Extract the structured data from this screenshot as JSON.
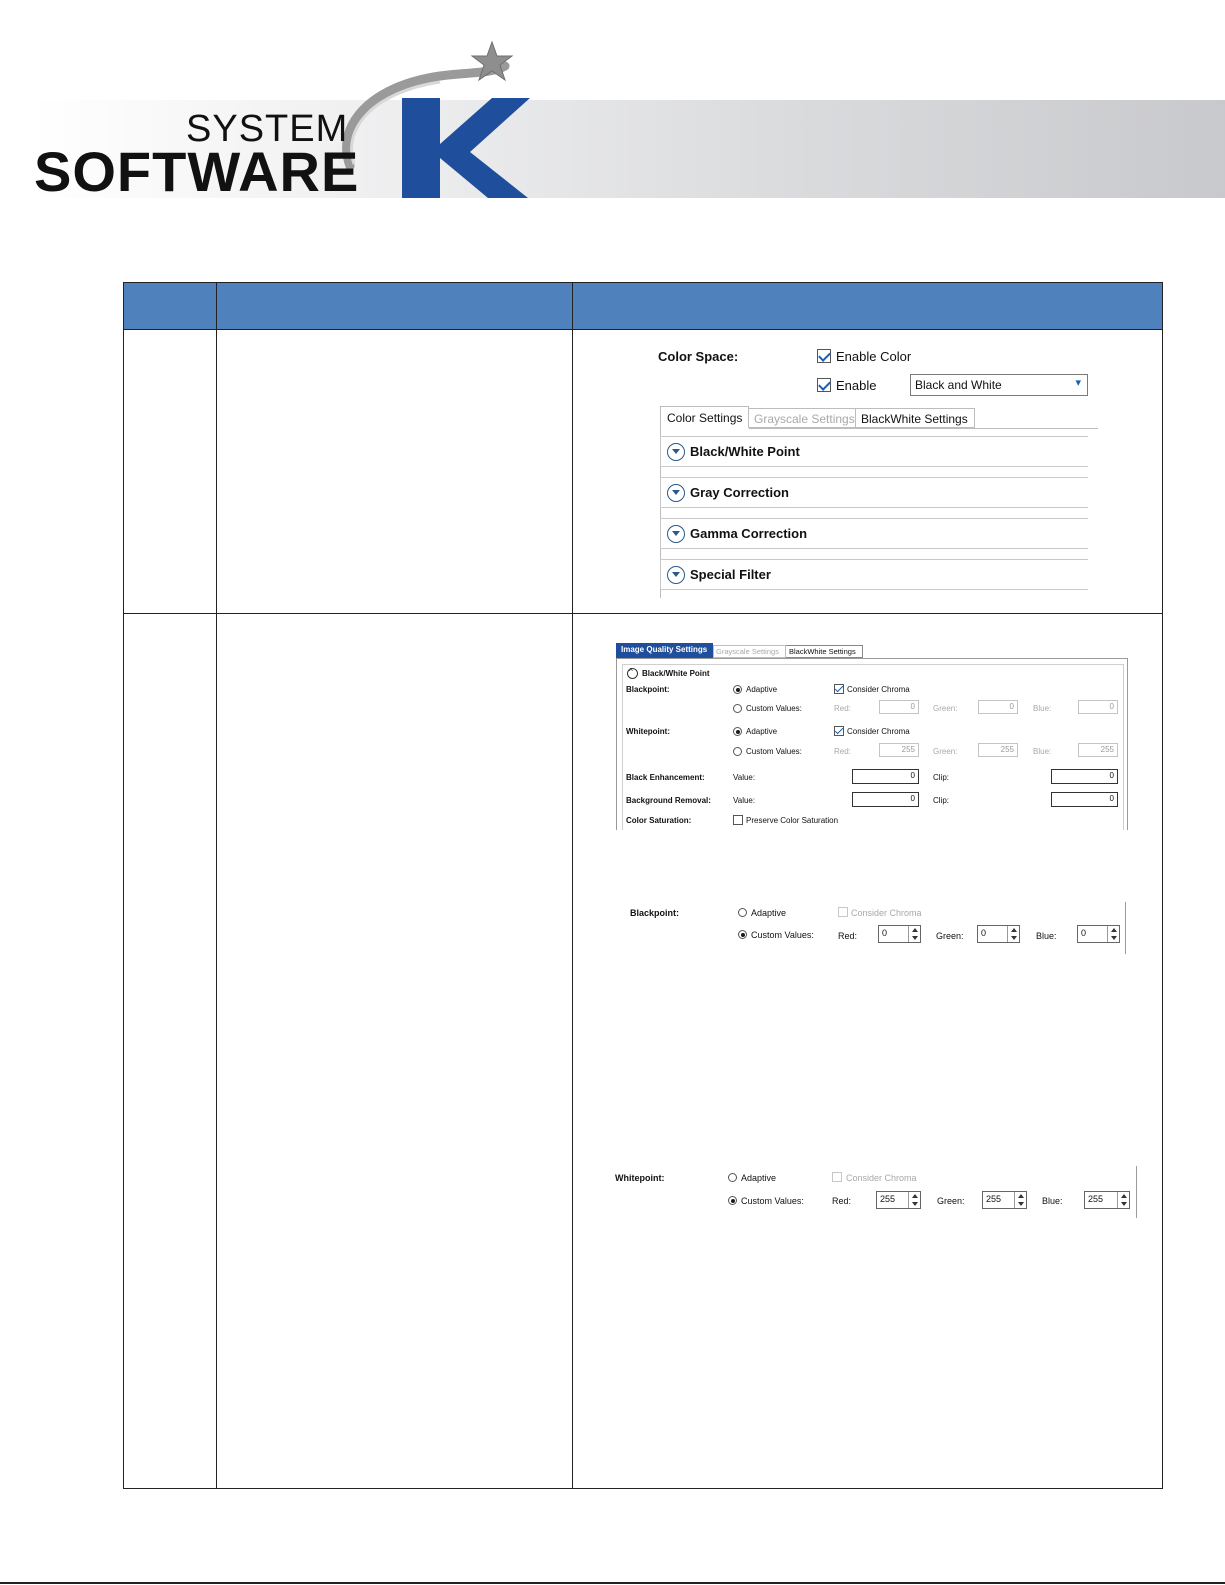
{
  "logo": {
    "line1": "SYSTEM",
    "line2": "SOFTWARE",
    "letter": "K"
  },
  "color_space": {
    "label": "Color Space:",
    "enable_color_label": "Enable Color",
    "enable_label": "Enable",
    "mode_value": "Black and White",
    "tabs": [
      "Color Settings",
      "Grayscale Settings",
      "BlackWhite Settings"
    ],
    "sections": [
      "Black/White Point",
      "Gray Correction",
      "Gamma Correction",
      "Special Filter"
    ]
  },
  "iq": {
    "tabs": [
      "Image Quality Settings",
      "Grayscale Settings",
      "BlackWhite Settings"
    ],
    "section_title": "Black/White Point",
    "blackpoint_label": "Blackpoint:",
    "whitepoint_label": "Whitepoint:",
    "adaptive": "Adaptive",
    "consider_chroma": "Consider Chroma",
    "custom_values": "Custom Values:",
    "red": "Red:",
    "green": "Green:",
    "blue": "Blue:",
    "bp_values": [
      "0",
      "0",
      "0"
    ],
    "wp_values": [
      "255",
      "255",
      "255"
    ],
    "black_enhancement_label": "Black Enhancement:",
    "background_removal_label": "Background Removal:",
    "color_saturation_label": "Color Saturation:",
    "value_label": "Value:",
    "clip_label": "Clip:",
    "be_value": "0",
    "be_clip": "0",
    "br_value": "0",
    "br_clip": "0",
    "preserve_label": "Preserve Color Saturation"
  },
  "bp_detail": {
    "label": "Blackpoint:",
    "adaptive": "Adaptive",
    "consider_chroma": "Consider Chroma",
    "custom_values": "Custom Values:",
    "red": "Red:",
    "green": "Green:",
    "blue": "Blue:",
    "values": [
      "0",
      "0",
      "0"
    ]
  },
  "wp_detail": {
    "label": "Whitepoint:",
    "adaptive": "Adaptive",
    "consider_chroma": "Consider Chroma",
    "custom_values": "Custom Values:",
    "red": "Red:",
    "green": "Green:",
    "blue": "Blue:",
    "values": [
      "255",
      "255",
      "255"
    ]
  },
  "colors": {
    "header_blue": "#4f81bd",
    "tab_active": "#1f4e9c",
    "accent": "#1a5fb4"
  }
}
